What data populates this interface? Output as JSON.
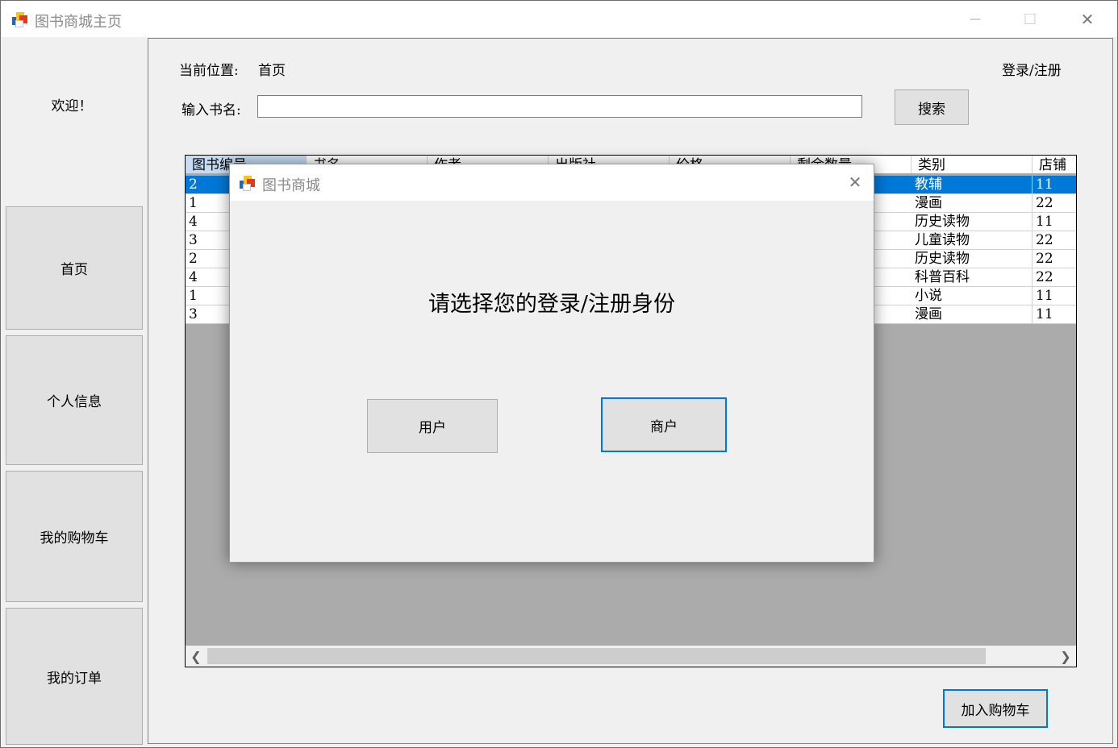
{
  "window": {
    "title": "图书商城主页",
    "controls": {
      "minimize": "—",
      "maximize": "☐",
      "close": "✕"
    }
  },
  "sidebar": {
    "welcome": "欢迎！",
    "items": [
      {
        "label": "首页"
      },
      {
        "label": "个人信息"
      },
      {
        "label": "我的购物车"
      },
      {
        "label": "我的订单"
      }
    ]
  },
  "header": {
    "location_label": "当前位置:",
    "location_value": "首页",
    "login_link": "登录/注册"
  },
  "search": {
    "label": "输入书名:",
    "value": "",
    "button": "搜索"
  },
  "table": {
    "columns": [
      "图书编号",
      "书名",
      "作者",
      "出版社",
      "价格",
      "剩余数量",
      "类别",
      "店铺"
    ],
    "rows": [
      {
        "id": "2",
        "category": "教辅",
        "shop": "11"
      },
      {
        "id": "1",
        "category": "漫画",
        "shop": "22"
      },
      {
        "id": "4",
        "category": "历史读物",
        "shop": "11"
      },
      {
        "id": "3",
        "category": "儿童读物",
        "shop": "22"
      },
      {
        "id": "2",
        "category": "历史读物",
        "shop": "22"
      },
      {
        "id": "4",
        "category": "科普百科",
        "shop": "22"
      },
      {
        "id": "1",
        "category": "小说",
        "shop": "11"
      },
      {
        "id": "3",
        "category": "漫画",
        "shop": "11"
      }
    ],
    "selected_row": 0
  },
  "add_to_cart": "加入购物车",
  "dialog": {
    "title": "图书商城",
    "close": "✕",
    "prompt": "请选择您的登录/注册身份",
    "user_button": "用户",
    "merchant_button": "商户"
  },
  "colors": {
    "selection": "#0078d7",
    "header_selected": "#c5dcf3",
    "grid_background": "#ababab",
    "window_background": "#f0f0f0",
    "button_face": "#e1e1e1"
  },
  "icons": [
    "app-icon",
    "minimize-icon",
    "maximize-icon",
    "close-icon",
    "scroll-left-icon",
    "scroll-right-icon"
  ]
}
